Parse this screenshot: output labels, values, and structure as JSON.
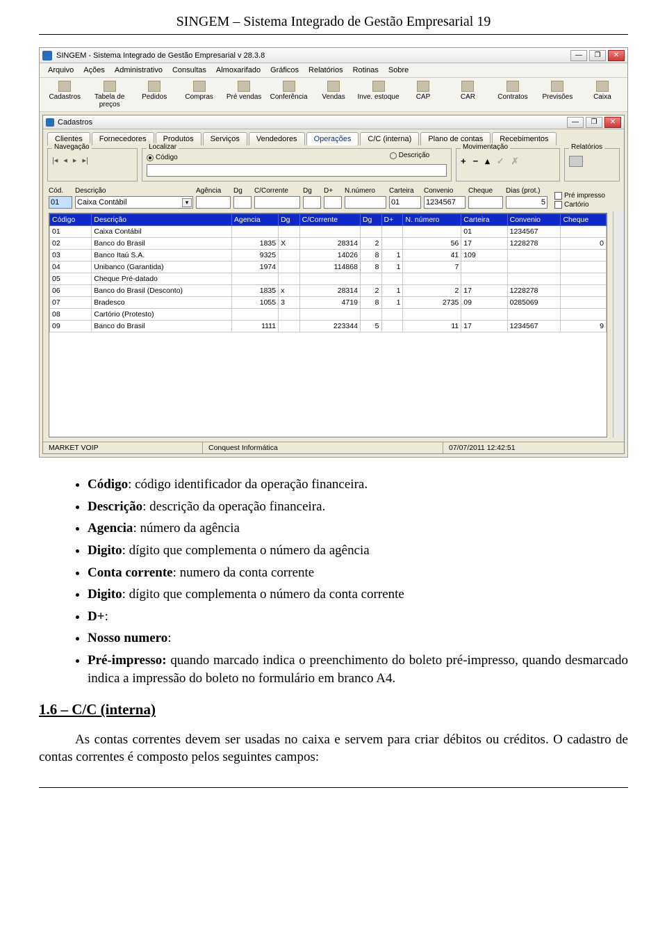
{
  "doc": {
    "header": "SINGEM – Sistema Integrado de Gestão Empresarial 19",
    "bullets": [
      {
        "b": "Código",
        "t": ": código identificador da operação financeira."
      },
      {
        "b": "Descrição",
        "t": ": descrição da operação financeira."
      },
      {
        "b": "Agencia",
        "t": ": número da agência"
      },
      {
        "b": "Digito",
        "t": ": dígito que complementa o número da agência"
      },
      {
        "b": "Conta corrente",
        "t": ": numero da conta corrente"
      },
      {
        "b": "Digito",
        "t": ": dígito que complementa o número da conta corrente"
      },
      {
        "b": "D+",
        "t": ":"
      },
      {
        "b": "Nosso numero",
        "t": ":"
      },
      {
        "b": "Pré-impresso:",
        "t": " quando marcado indica o preenchimento do boleto pré-impresso, quando desmarcado indica a impressão do boleto no formulário em branco A4."
      }
    ],
    "section_title": "1.6 – C/C (interna)",
    "para": "As contas correntes devem ser usadas no caixa e servem para criar débitos ou créditos. O cadastro de contas correntes é composto pelos seguintes campos:"
  },
  "app": {
    "title": "SINGEM - Sistema Integrado de Gestão Empresarial   v 28.3.8",
    "menus": [
      "Arquivo",
      "Ações",
      "Administrativo",
      "Consultas",
      "Almoxarifado",
      "Gráficos",
      "Relatórios",
      "Rotinas",
      "Sobre"
    ],
    "toolbar": [
      "Cadastros",
      "Tabela de preços",
      "Pedidos",
      "Compras",
      "Pré vendas",
      "Conferência",
      "Vendas",
      "Inve. estoque",
      "CAP",
      "CAR",
      "Contratos",
      "Previsões",
      "Caixa"
    ],
    "child_title": "Cadastros",
    "subtabs": [
      "Clientes",
      "Fornecedores",
      "Produtos",
      "Serviços",
      "Vendedores",
      "Operações",
      "C/C (interna)",
      "Plano de contas",
      "Recebimentos"
    ],
    "active_tab": "Operações",
    "groups": {
      "nav": "Navegação",
      "loc": "Localizar",
      "mov": "Movimentação",
      "rep": "Relatórios"
    },
    "loc_radio": {
      "codigo": "Código",
      "descricao": "Descrição"
    },
    "form_labels": {
      "cod": "Cód.",
      "desc": "Descrição",
      "ag": "Agência",
      "dg1": "Dg",
      "cc": "C/Corrente",
      "dg2": "Dg",
      "dplus": "D+",
      "nn": "N.número",
      "cart": "Carteira",
      "conv": "Convenio",
      "chq": "Cheque",
      "dias": "Dias (prot.)"
    },
    "chk": {
      "pre": "Pré impresso",
      "cart": "Cartório"
    },
    "form_vals": {
      "cod": "01",
      "desc": "Caixa Contábil",
      "cart": "01",
      "conv": "1234567",
      "dias": "5"
    },
    "grid_headers": [
      "Código",
      "Descrição",
      "Agencia",
      "Dg",
      "C/Corrente",
      "Dg",
      "D+",
      "N. número",
      "Carteira",
      "Convenio",
      "Cheque"
    ],
    "rows": [
      {
        "cod": "01",
        "desc": "Caixa Contábil",
        "ag": "",
        "dg1": "",
        "cc": "",
        "dg2": "",
        "dp": "",
        "nn": "",
        "cart": "01",
        "conv": "1234567",
        "chq": ""
      },
      {
        "cod": "02",
        "desc": "Banco do Brasil",
        "ag": "1835",
        "dg1": "X",
        "cc": "28314",
        "dg2": "2",
        "dp": "",
        "nn": "56",
        "cart": "17",
        "conv": "1228278",
        "chq": "0"
      },
      {
        "cod": "03",
        "desc": "Banco Itaú S.A.",
        "ag": "9325",
        "dg1": "",
        "cc": "14026",
        "dg2": "8",
        "dp": "1",
        "nn": "41",
        "cart": "109",
        "conv": "",
        "chq": ""
      },
      {
        "cod": "04",
        "desc": "Unibanco (Garantida)",
        "ag": "1974",
        "dg1": "",
        "cc": "114868",
        "dg2": "8",
        "dp": "1",
        "nn": "7",
        "cart": "",
        "conv": "",
        "chq": ""
      },
      {
        "cod": "05",
        "desc": "Cheque Pré-datado",
        "ag": "",
        "dg1": "",
        "cc": "",
        "dg2": "",
        "dp": "",
        "nn": "",
        "cart": "",
        "conv": "",
        "chq": ""
      },
      {
        "cod": "06",
        "desc": "Banco do Brasil (Desconto)",
        "ag": "1835",
        "dg1": "x",
        "cc": "28314",
        "dg2": "2",
        "dp": "1",
        "nn": "2",
        "cart": "17",
        "conv": "1228278",
        "chq": ""
      },
      {
        "cod": "07",
        "desc": "Bradesco",
        "ag": "1055",
        "dg1": "3",
        "cc": "4719",
        "dg2": "8",
        "dp": "1",
        "nn": "2735",
        "cart": "09",
        "conv": "0285069",
        "chq": ""
      },
      {
        "cod": "08",
        "desc": "Cartório (Protesto)",
        "ag": "",
        "dg1": "",
        "cc": "",
        "dg2": "",
        "dp": "",
        "nn": "",
        "cart": "",
        "conv": "",
        "chq": ""
      },
      {
        "cod": "09",
        "desc": "Banco do Brasil",
        "ag": "1111",
        "dg1": "",
        "cc": "223344",
        "dg2": "5",
        "dp": "",
        "nn": "11",
        "cart": "17",
        "conv": "1234567",
        "chq": "9"
      }
    ],
    "status": {
      "l": "MARKET VOIP",
      "c": "Conquest Informática",
      "r": "07/07/2011 12:42:51"
    }
  }
}
